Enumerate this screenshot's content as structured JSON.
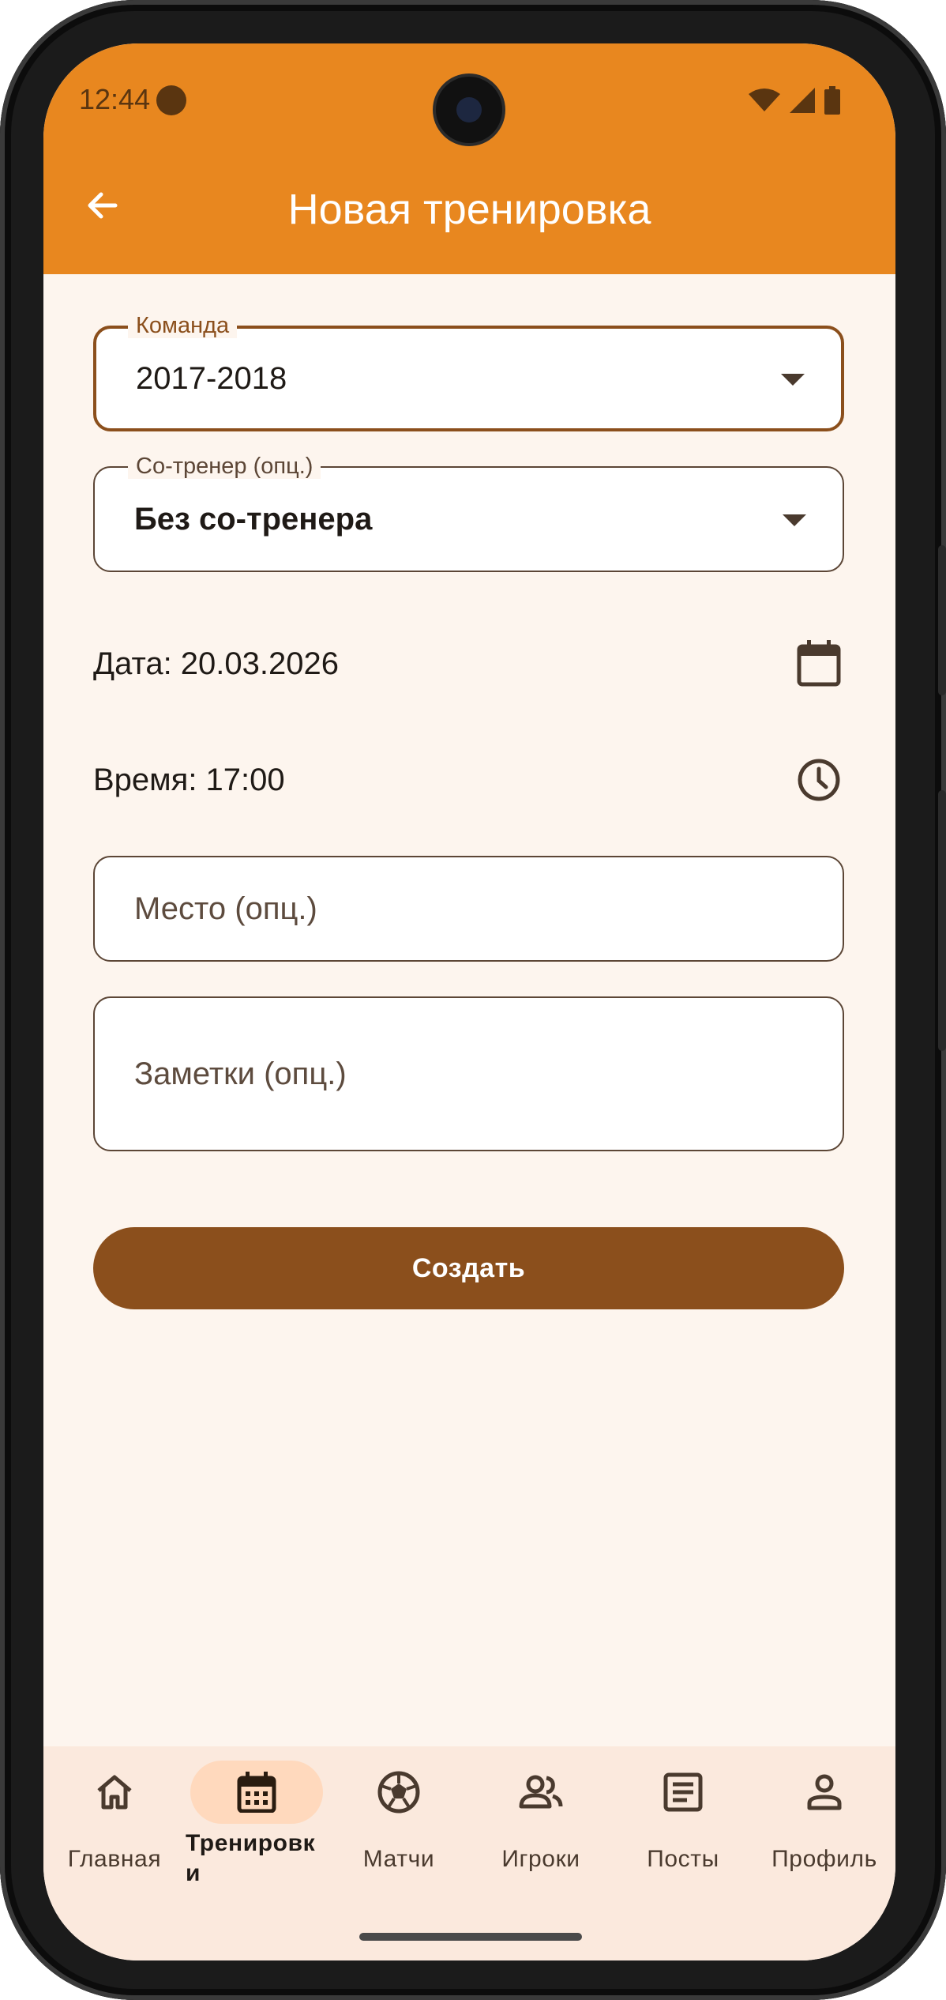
{
  "status_bar": {
    "time": "12:44"
  },
  "app_bar": {
    "title": "Новая тренировка"
  },
  "form": {
    "team": {
      "label": "Команда",
      "value": "2017-2018"
    },
    "cocoach": {
      "label": "Со-тренер (опц.)",
      "value": "Без со-тренера"
    },
    "date_text": "Дата: 20.03.2026",
    "time_text": "Время: 17:00",
    "place_placeholder": "Место (опц.)",
    "notes_placeholder": "Заметки (опц.)",
    "create_label": "Создать"
  },
  "bottom_nav": {
    "items": [
      {
        "label": "Главная",
        "icon": "home-icon"
      },
      {
        "label": "Тренировк\nи",
        "icon": "calendar-icon",
        "active": true
      },
      {
        "label": "Матчи",
        "icon": "soccer-ball-icon"
      },
      {
        "label": "Игроки",
        "icon": "group-icon"
      },
      {
        "label": "Посты",
        "icon": "article-icon"
      },
      {
        "label": "Профиль",
        "icon": "person-icon"
      }
    ]
  },
  "colors": {
    "app_bar": "#e8871f",
    "primary": "#8b4f1c",
    "background": "#fdf5ee",
    "nav_background": "#fbe9dd",
    "nav_active_pill": "#ffd9bd"
  }
}
